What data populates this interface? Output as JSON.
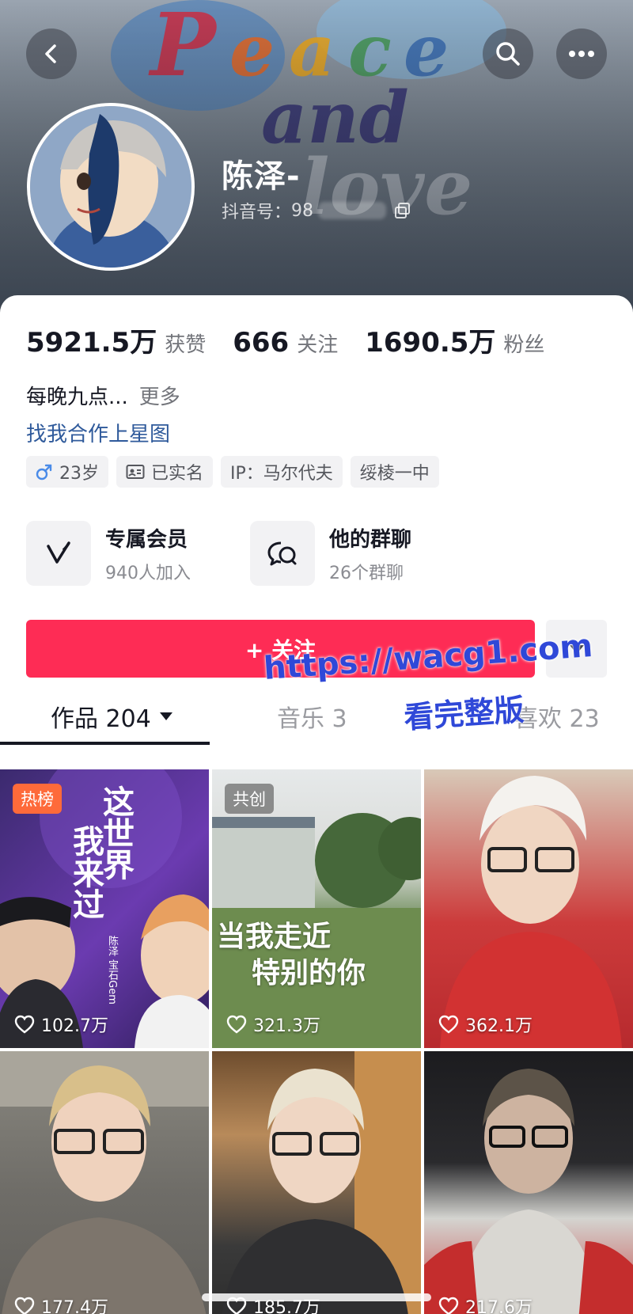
{
  "header": {
    "cover_text": "Peace and love",
    "name": "陈泽-",
    "id_label": "抖音号：",
    "id_value": "98"
  },
  "stats": [
    {
      "value": "5921.5万",
      "label": "获赞"
    },
    {
      "value": "666",
      "label": "关注"
    },
    {
      "value": "1690.5万",
      "label": "粉丝"
    }
  ],
  "bio": {
    "text": "每晚九点...",
    "more": "更多"
  },
  "link": "找我合作上星图",
  "tags": [
    {
      "icon": "male-icon",
      "label": "23岁"
    },
    {
      "icon": "id-card-icon",
      "label": "已实名"
    },
    {
      "icon": "",
      "label": "IP：马尔代夫"
    },
    {
      "icon": "",
      "label": "绥棱一中"
    }
  ],
  "features": [
    {
      "icon": "membership-v-icon",
      "title": "专属会员",
      "sub": "940人加入"
    },
    {
      "icon": "group-chat-icon",
      "title": "他的群聊",
      "sub": "26个群聊"
    }
  ],
  "follow_button": "+ 关注",
  "tabs": {
    "works": "作品 204",
    "music": "音乐 3",
    "likes": "喜欢 23"
  },
  "watermark": {
    "url": "https://wacg1.com",
    "sub": "看完整版"
  },
  "videos": [
    {
      "badge": "热榜",
      "likes": "102.7万",
      "cover_text": [
        "这世界",
        "我来过"
      ],
      "credit": "陈泽 宝石Gem"
    },
    {
      "badge": "共创",
      "likes": "321.3万",
      "cover_text": [
        "当我走近",
        "特别的你"
      ]
    },
    {
      "badge": "",
      "likes": "362.1万"
    },
    {
      "badge": "",
      "likes": "177.4万"
    },
    {
      "badge": "",
      "likes": "185.7万"
    },
    {
      "badge": "",
      "likes": "217.6万"
    }
  ],
  "colors": {
    "accent": "#fe2c55",
    "link": "#2f5a9b",
    "hot_badge": "#fe6a3a"
  }
}
